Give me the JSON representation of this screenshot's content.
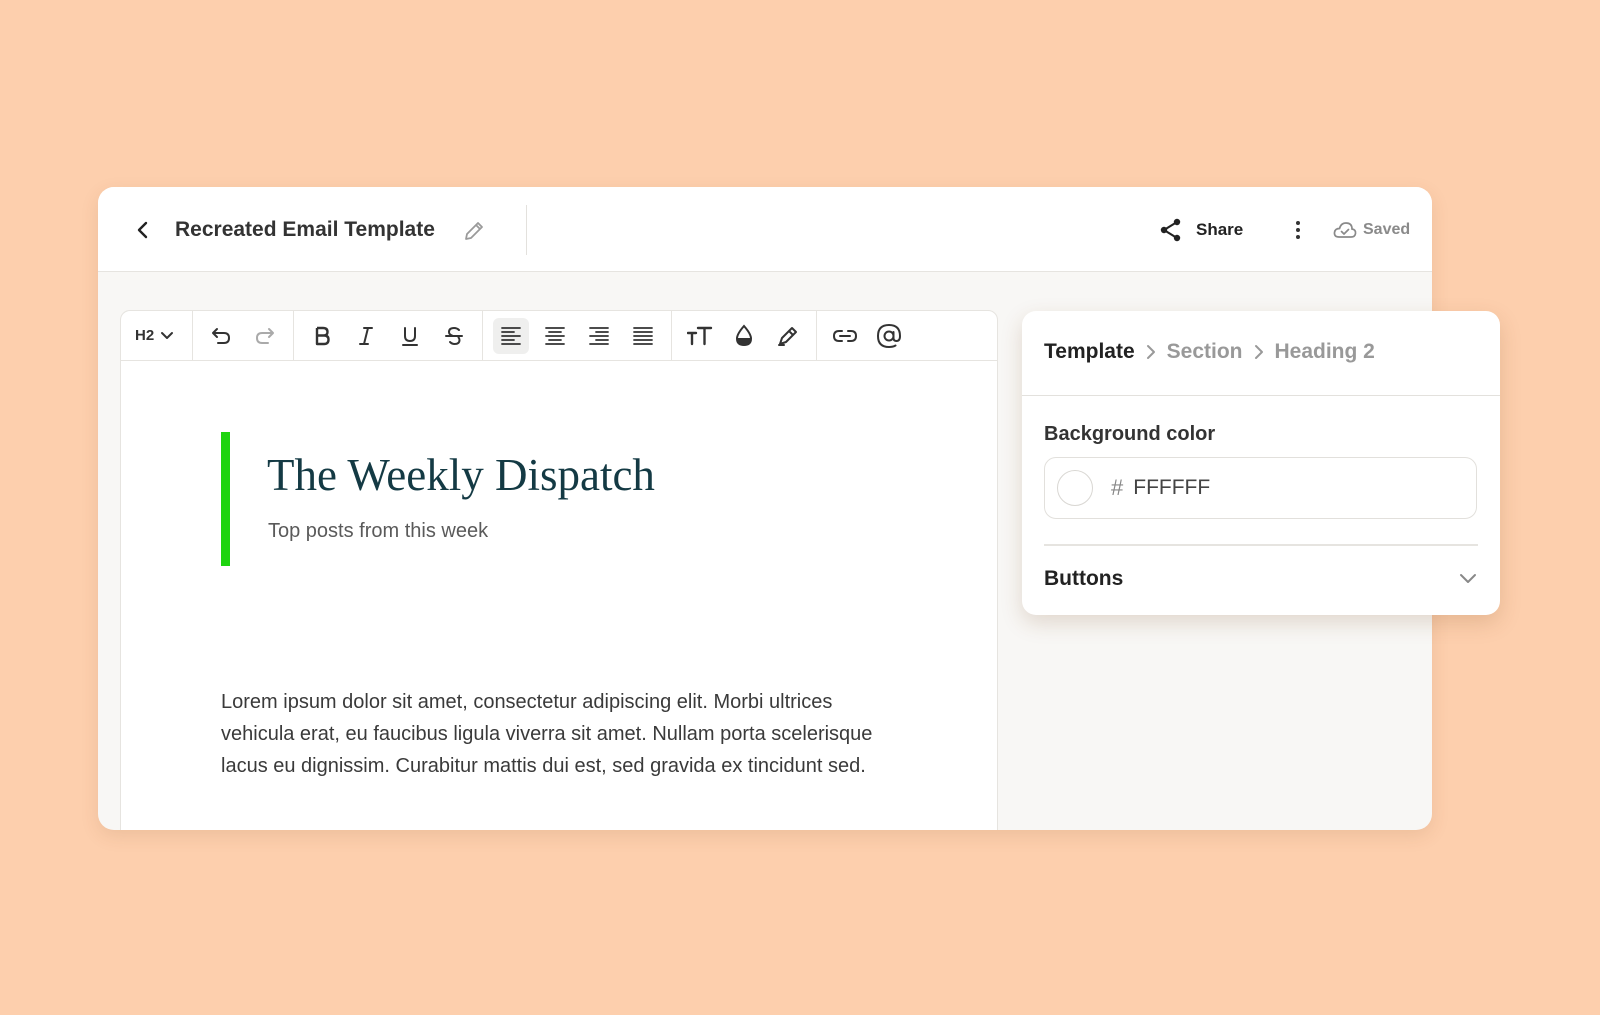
{
  "header": {
    "title": "Recreated Email Template",
    "share_label": "Share",
    "saved_label": "Saved"
  },
  "toolbar": {
    "heading_level": "H2",
    "buttons": [
      "undo",
      "redo",
      "bold",
      "italic",
      "underline",
      "strikethrough",
      "align-left",
      "align-center",
      "align-right",
      "justify",
      "text-size",
      "text-color",
      "highlight",
      "link",
      "mention"
    ],
    "active_button": "align-left"
  },
  "content": {
    "title": "The Weekly Dispatch",
    "subtitle": "Top posts from this week",
    "body": "Lorem ipsum dolor sit amet, consectetur adipiscing elit. Morbi ultrices vehicula erat, eu faucibus ligula viverra sit amet. Nullam porta scelerisque lacus eu dignissim. Curabitur mattis dui est, sed gravida ex tincidunt sed.",
    "accent_color": "#1ed40f"
  },
  "panel": {
    "breadcrumb": [
      "Template",
      "Section",
      "Heading 2"
    ],
    "background_label": "Background color",
    "hash_symbol": "#",
    "background_value": "FFFFFF",
    "accordion_label": "Buttons"
  },
  "colors": {
    "page_background": "#fdcfad",
    "title_color": "#143a44"
  }
}
